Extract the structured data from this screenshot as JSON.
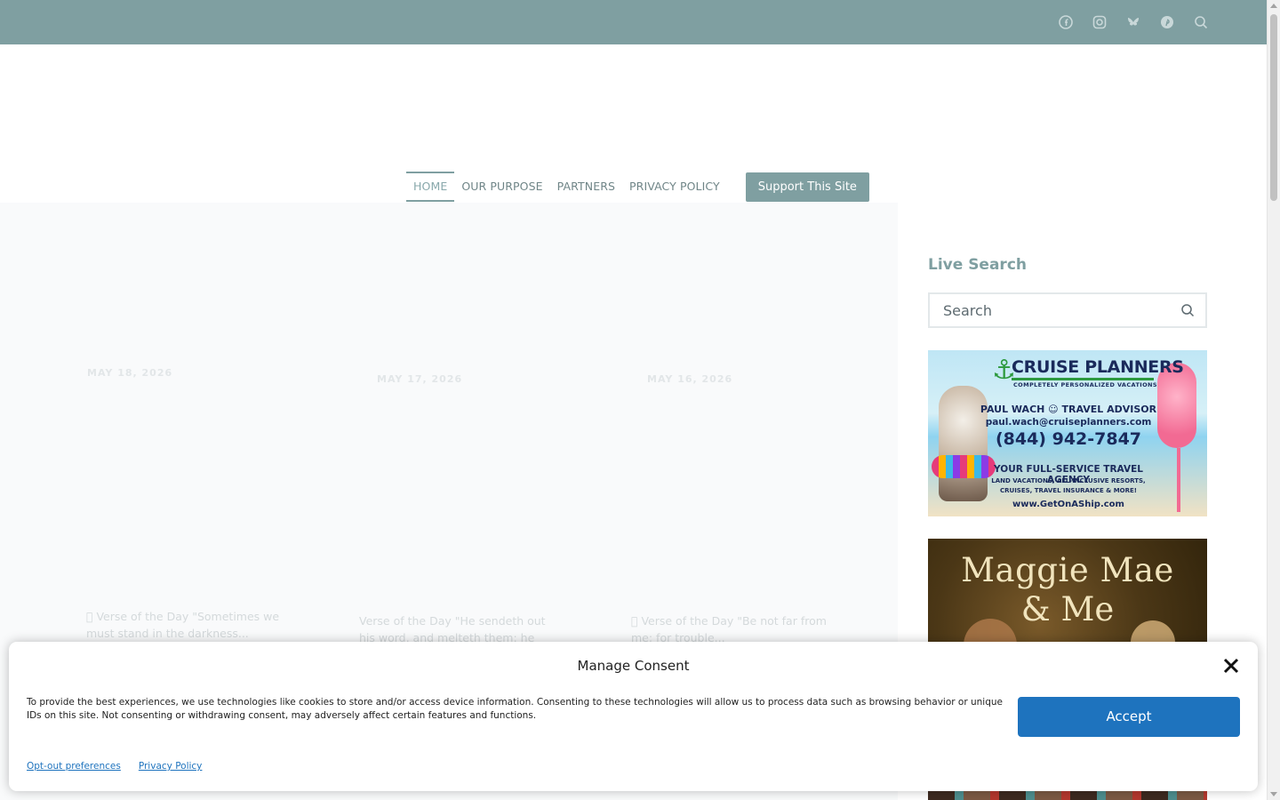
{
  "topbar": {
    "social_icons": [
      "facebook-icon",
      "instagram-icon",
      "bluesky-icon",
      "pinterest-icon",
      "search-icon"
    ],
    "background": "#7f9fa1"
  },
  "nav": {
    "items": [
      "HOME",
      "OUR PURPOSE",
      "PARTNERS",
      "PRIVACY POLICY"
    ],
    "active": "HOME",
    "support_button": "Support This Site"
  },
  "posts": [
    {
      "date": "MAY 18, 2026",
      "excerpt": "\u0000 Verse of the Day \"Sometimes we must stand in the darkness..."
    },
    {
      "date": "MAY 17, 2026",
      "excerpt": "Verse of the Day \"He sendeth out his word, and melteth them: he causeth his..."
    },
    {
      "date": "MAY 16, 2026",
      "excerpt": "\u0000 Verse of the Day \"Be not far from me; for trouble..."
    }
  ],
  "sidebar": {
    "live_search_title": "Live Search",
    "search_placeholder": "Search",
    "ad_cruise": {
      "brand": "CRUISE PLANNERS",
      "tagline": "COMPLETELY PERSONALIZED VACATIONS",
      "agent": "PAUL WACH ☺ TRAVEL ADVISOR",
      "email": "paul.wach@cruiseplanners.com",
      "phone": "(844) 942-7847",
      "headline": "YOUR FULL-SERVICE TRAVEL AGENCY",
      "services": "LAND VACATIONS, ALL-INCLUSIVE RESORTS, CRUISES, TRAVEL INSURANCE & MORE!",
      "url": "www.GetOnAShip.com"
    },
    "ad_book": {
      "line1": "Maggie Mae",
      "line2": "& Me"
    }
  },
  "consent": {
    "title": "Manage Consent",
    "text": "To provide the best experiences, we use technologies like cookies to store and/or access device information. Consenting to these technologies will allow us to process data such as browsing behavior or unique IDs on this site. Not consenting or withdrawing consent, may adversely affect certain features and functions.",
    "accept": "Accept",
    "links": [
      "Opt-out preferences",
      "Privacy Policy"
    ]
  },
  "colors": {
    "accent": "#7f9fa1",
    "button_blue": "#1e73be"
  }
}
